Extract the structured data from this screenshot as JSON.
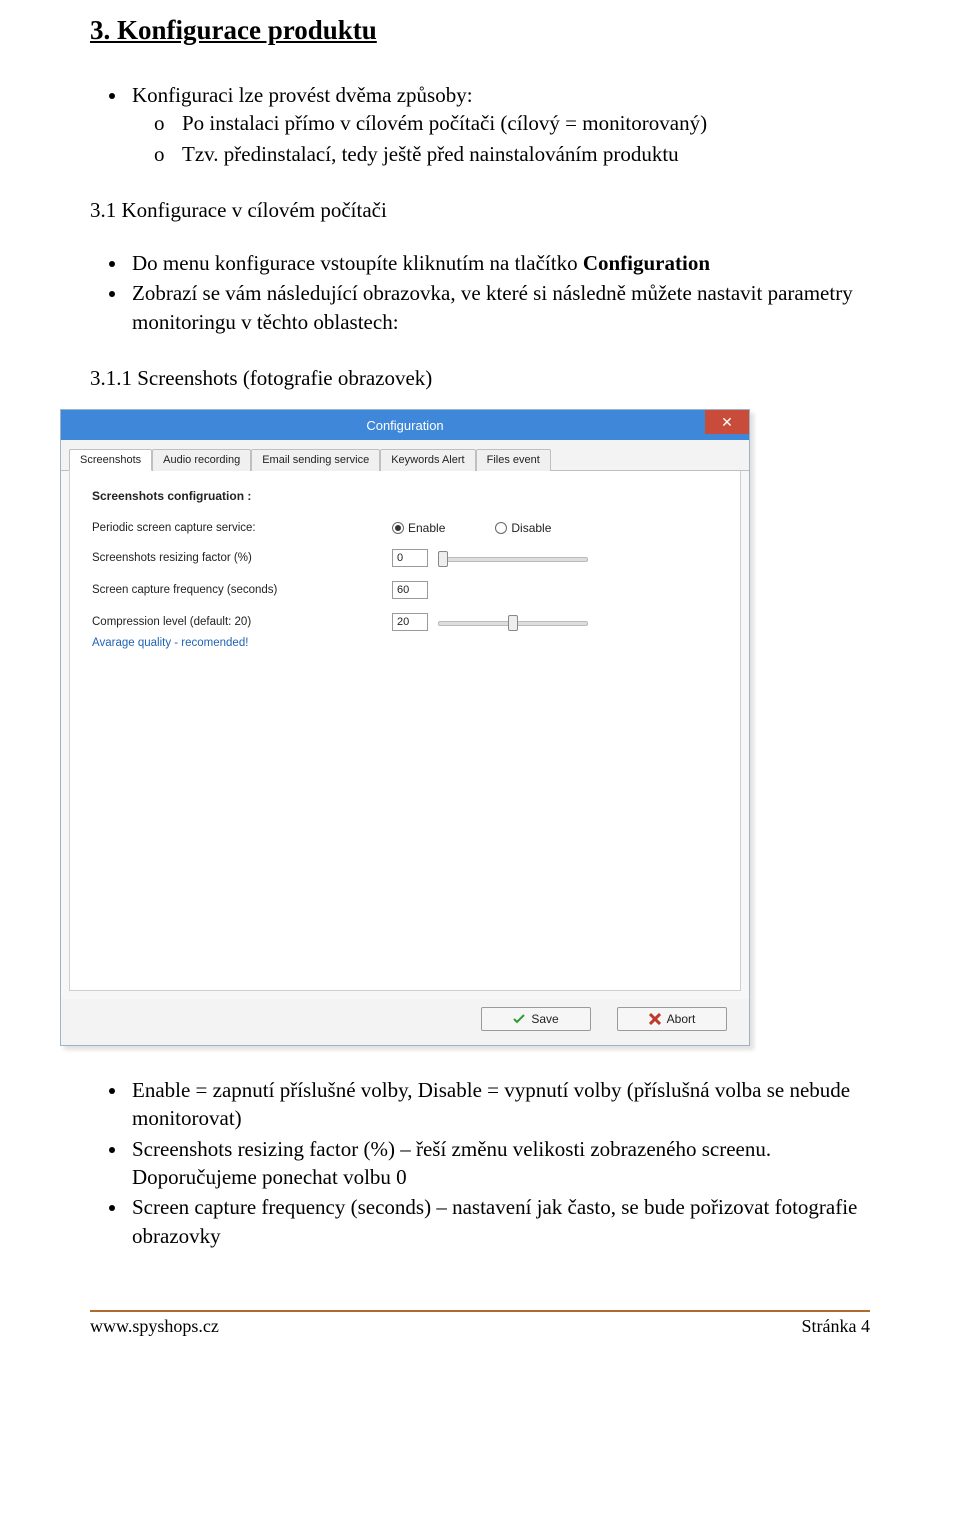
{
  "section": {
    "title": "3. Konfigurace produktu",
    "intro": "Konfiguraci lze provést dvěma způsoby:",
    "intro_sub": [
      "Po instalaci přímo v cílovém počítači (cílový = monitorovaný)",
      "Tzv. předinstalací, tedy ještě před nainstalováním produktu"
    ],
    "sub31_title": "3.1 Konfigurace v cílovém počítači",
    "sub31_b1_pre": "Do menu konfigurace vstoupíte kliknutím na tlačítko ",
    "sub31_b1_bold": "Configuration",
    "sub31_b2": "Zobrazí se vám následující obrazovka, ve které si následně můžete nastavit parametry monitoringu v těchto oblastech:",
    "sub311_title": "3.1.1    Screenshots (fotografie obrazovek)"
  },
  "shot": {
    "window_title": "Configuration",
    "close_glyph": "✕",
    "tabs": [
      "Screenshots",
      "Audio recording",
      "Email sending service",
      "Keywords Alert",
      "Files event"
    ],
    "panel_head": "Screenshots configruation :",
    "rows": {
      "periodic": {
        "label": "Periodic screen capture service:",
        "enable": "Enable",
        "disable": "Disable"
      },
      "resize": {
        "label": "Screenshots resizing factor (%)",
        "value": "0"
      },
      "freq": {
        "label": "Screen capture frequency (seconds)",
        "value": "60"
      },
      "compress": {
        "label": "Compression level (default: 20)",
        "value": "20"
      }
    },
    "blue_note": "Avarage quality - recomended!",
    "save": "Save",
    "abort": "Abort"
  },
  "after": {
    "b1": "Enable = zapnutí příslušné volby, Disable = vypnutí volby (příslušná volba se nebude monitorovat)",
    "b2": "Screenshots resizing factor (%) – řeší změnu velikosti zobrazeného screenu. Doporučujeme ponechat volbu 0",
    "b3": "Screen capture frequency (seconds) – nastavení jak často, se bude pořizovat fotografie obrazovky"
  },
  "footer": {
    "left": "www.spyshops.cz",
    "right": "Stránka 4"
  }
}
